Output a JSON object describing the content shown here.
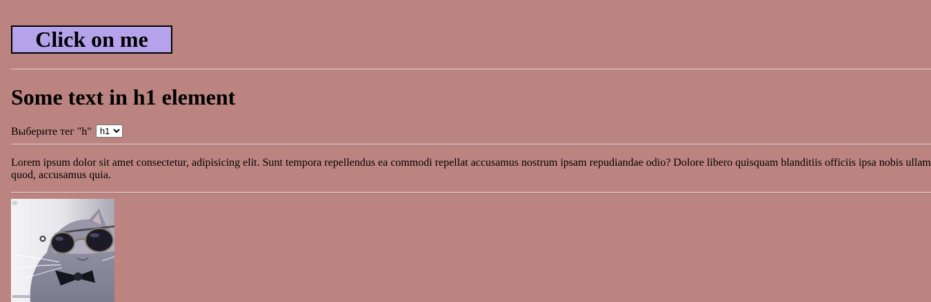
{
  "button": {
    "label": "Click on me"
  },
  "heading": {
    "text": "Some text in h1 element"
  },
  "tag_selector": {
    "label": "Выберите тег \"h\"",
    "selected": "h1",
    "options": [
      "h1"
    ]
  },
  "paragraph": {
    "line1": "Lorem ipsum dolor sit amet consectetur, adipisicing elit. Sunt tempora repellendus ea commodi repellat accusamus nostrum ipsam repudiandae odio? Dolore libero quisquam blanditiis officiis ipsa nobis ullam",
    "line2": "quod, accusamus quia."
  },
  "colors": {
    "page_background": "#bc8480",
    "button_background": "#b4a2ea"
  }
}
